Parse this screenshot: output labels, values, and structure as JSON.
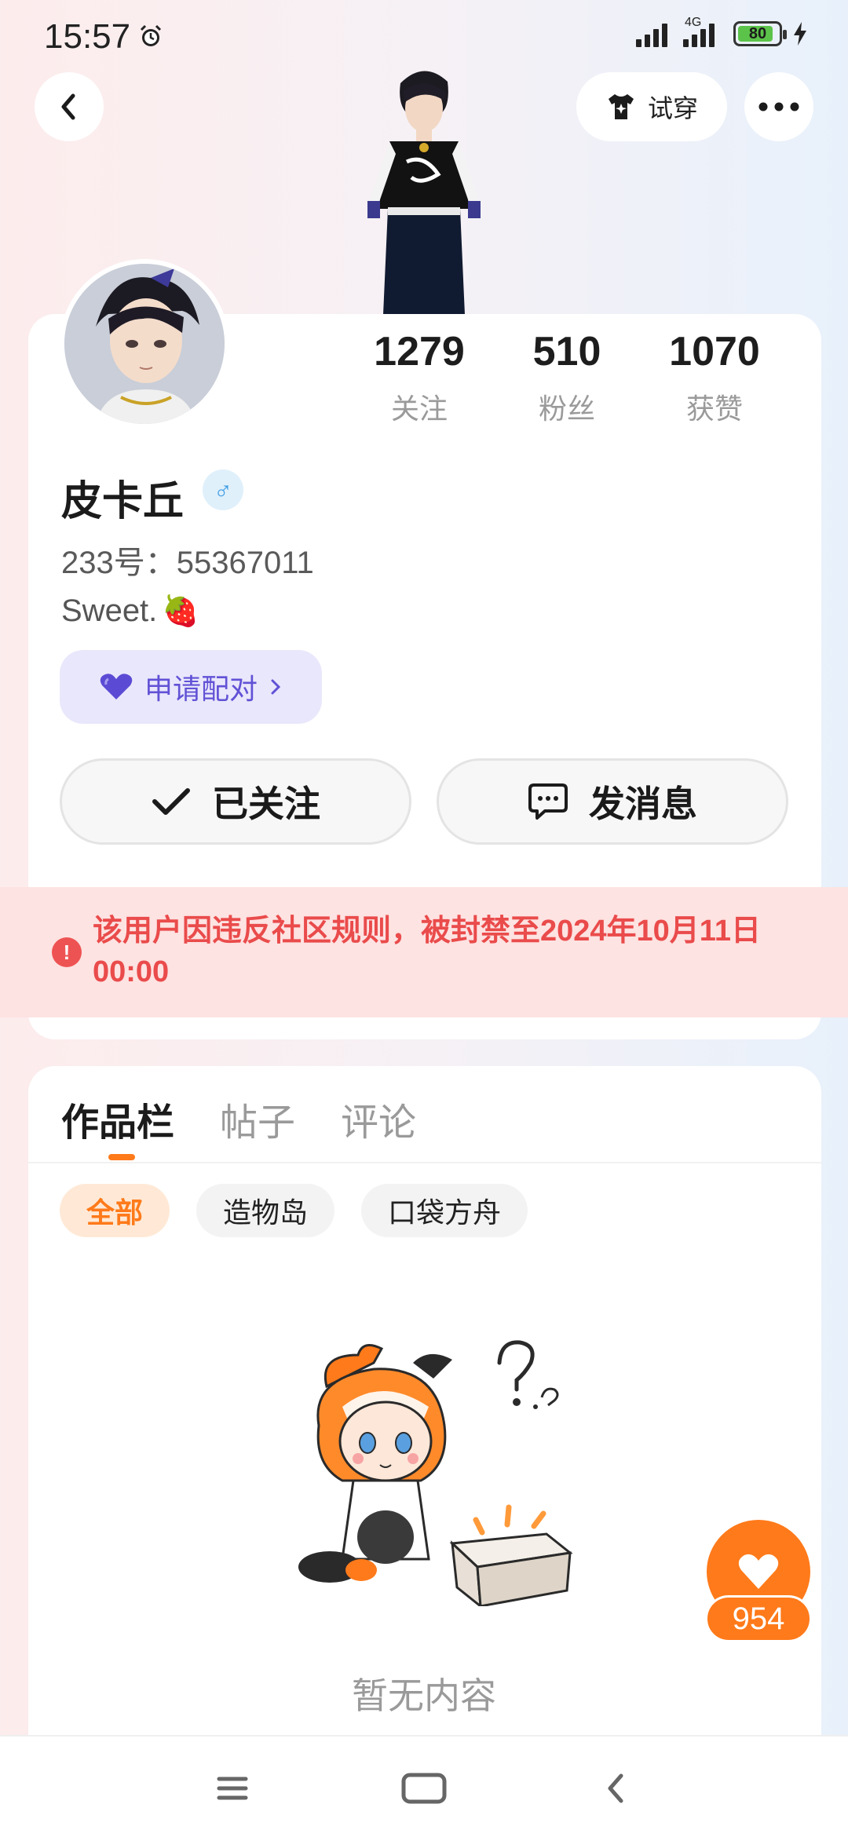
{
  "status_bar": {
    "time": "15:57",
    "network": "4G",
    "battery": "80"
  },
  "header": {
    "tryon_label": "试穿"
  },
  "profile": {
    "stats": [
      {
        "value": "1279",
        "label": "关注"
      },
      {
        "value": "510",
        "label": "粉丝"
      },
      {
        "value": "1070",
        "label": "获赞"
      }
    ],
    "name": "皮卡丘",
    "gender_symbol": "♂",
    "uid": "233号：55367011",
    "bio": "Sweet.",
    "bio_emoji": "🍓",
    "pair_label": "申请配对",
    "follow_label": "已关注",
    "message_label": "发消息"
  },
  "ban_notice": {
    "text": "该用户因违反社区规则，被封禁至2024年10月11日 00:00"
  },
  "content": {
    "tabs": [
      "作品栏",
      "帖子",
      "评论"
    ],
    "active_tab": 0,
    "chips": [
      "全部",
      "造物岛",
      "口袋方舟"
    ],
    "active_chip": 0,
    "empty_text": "暂无内容"
  },
  "like_fab": {
    "count": "954"
  },
  "colors": {
    "accent": "#ff7a1a",
    "ban_red": "#ea4b4b",
    "pair_purple": "#6152d6"
  }
}
